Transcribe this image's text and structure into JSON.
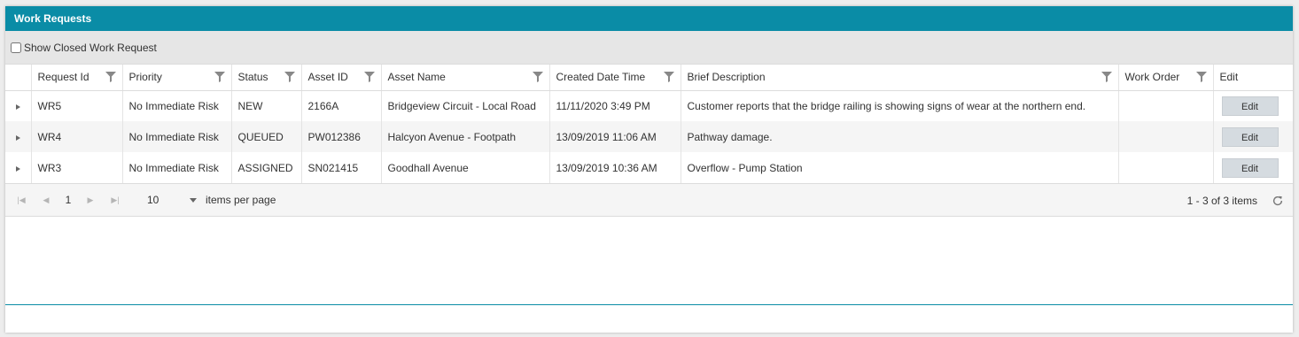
{
  "panel": {
    "title": "Work Requests",
    "accent_color": "#0a8ca6"
  },
  "toolbar": {
    "show_closed_label": "Show Closed Work Request",
    "show_closed_checked": false
  },
  "grid": {
    "columns": [
      {
        "label": "Request Id",
        "filterable": true
      },
      {
        "label": "Priority",
        "filterable": true
      },
      {
        "label": "Status",
        "filterable": true
      },
      {
        "label": "Asset ID",
        "filterable": true
      },
      {
        "label": "Asset Name",
        "filterable": true
      },
      {
        "label": "Created Date Time",
        "filterable": true
      },
      {
        "label": "Brief Description",
        "filterable": true
      },
      {
        "label": "Work Order",
        "filterable": true
      },
      {
        "label": "Edit",
        "filterable": false
      }
    ],
    "rows": [
      {
        "request_id": "WR5",
        "priority": "No Immediate Risk",
        "status": "NEW",
        "asset_id": "2166A",
        "asset_name": "Bridgeview Circuit - Local Road",
        "created": "11/11/2020 3:49 PM",
        "description": "Customer reports that the bridge railing is showing signs of wear at the northern end.",
        "work_order": "",
        "edit_label": "Edit"
      },
      {
        "request_id": "WR4",
        "priority": "No Immediate Risk",
        "status": "QUEUED",
        "asset_id": "PW012386",
        "asset_name": "Halcyon Avenue - Footpath",
        "created": "13/09/2019 11:06 AM",
        "description": "Pathway damage.",
        "work_order": "",
        "edit_label": "Edit"
      },
      {
        "request_id": "WR3",
        "priority": "No Immediate Risk",
        "status": "ASSIGNED",
        "asset_id": "SN021415",
        "asset_name": "Goodhall Avenue",
        "created": "13/09/2019 10:36 AM",
        "description": "Overflow - Pump Station",
        "work_order": "",
        "edit_label": "Edit"
      }
    ]
  },
  "pager": {
    "first_icon": "first-page-icon",
    "prev_icon": "previous-page-icon",
    "current_page": "1",
    "next_icon": "next-page-icon",
    "last_icon": "last-page-icon",
    "page_size": "10",
    "items_per_page_label": "items per page",
    "info": "1 - 3 of 3 items",
    "refresh_icon": "refresh-icon"
  }
}
